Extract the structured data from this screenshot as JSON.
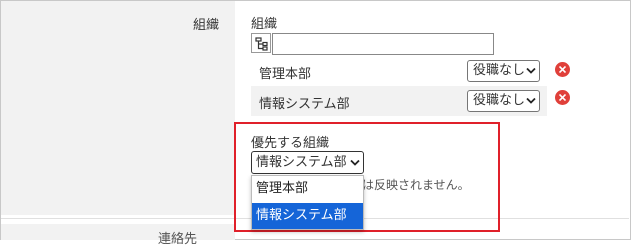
{
  "form": {
    "org_field_label": "組織",
    "contact_field_label": "連絡先"
  },
  "org_section": {
    "title": "組織",
    "search_value": "",
    "rows": [
      {
        "name": "管理本部",
        "role": "役職なし"
      },
      {
        "name": "情報システム部",
        "role": "役職なし"
      }
    ]
  },
  "priority": {
    "title": "優先する組織",
    "selected": "情報システム部",
    "note": "は反映されません。",
    "options": [
      "管理本部",
      "情報システム部"
    ]
  },
  "colors": {
    "highlight_border": "#e0202a",
    "remove_button": "#e0403a",
    "selected_option": "#1565d8",
    "label_column": "#f2f2f2"
  },
  "icons": {
    "tree": "org-tree-icon",
    "remove": "close-x-icon",
    "chevron": "chevron-down-icon"
  }
}
